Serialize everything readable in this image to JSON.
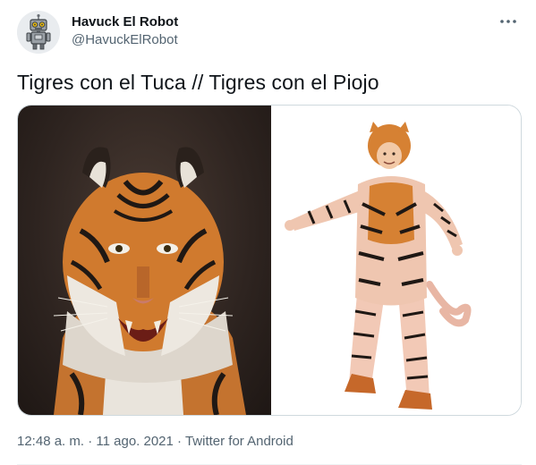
{
  "author": {
    "display_name": "Havuck El Robot",
    "handle": "@HavuckElRobot",
    "avatar_icon": "robot-avatar-icon"
  },
  "tweet": {
    "text": "Tigres con el Tuca // Tigres con el Piojo"
  },
  "media": {
    "left_image": "tiger-photo",
    "right_image": "tiger-costume-photo"
  },
  "meta": {
    "time": "12:48 a. m.",
    "separator1": " · ",
    "date": "11 ago. 2021",
    "separator2": " · ",
    "source": "Twitter for Android"
  },
  "colors": {
    "text_primary": "#0f1419",
    "text_secondary": "#536471",
    "border": "#cfd9de"
  }
}
